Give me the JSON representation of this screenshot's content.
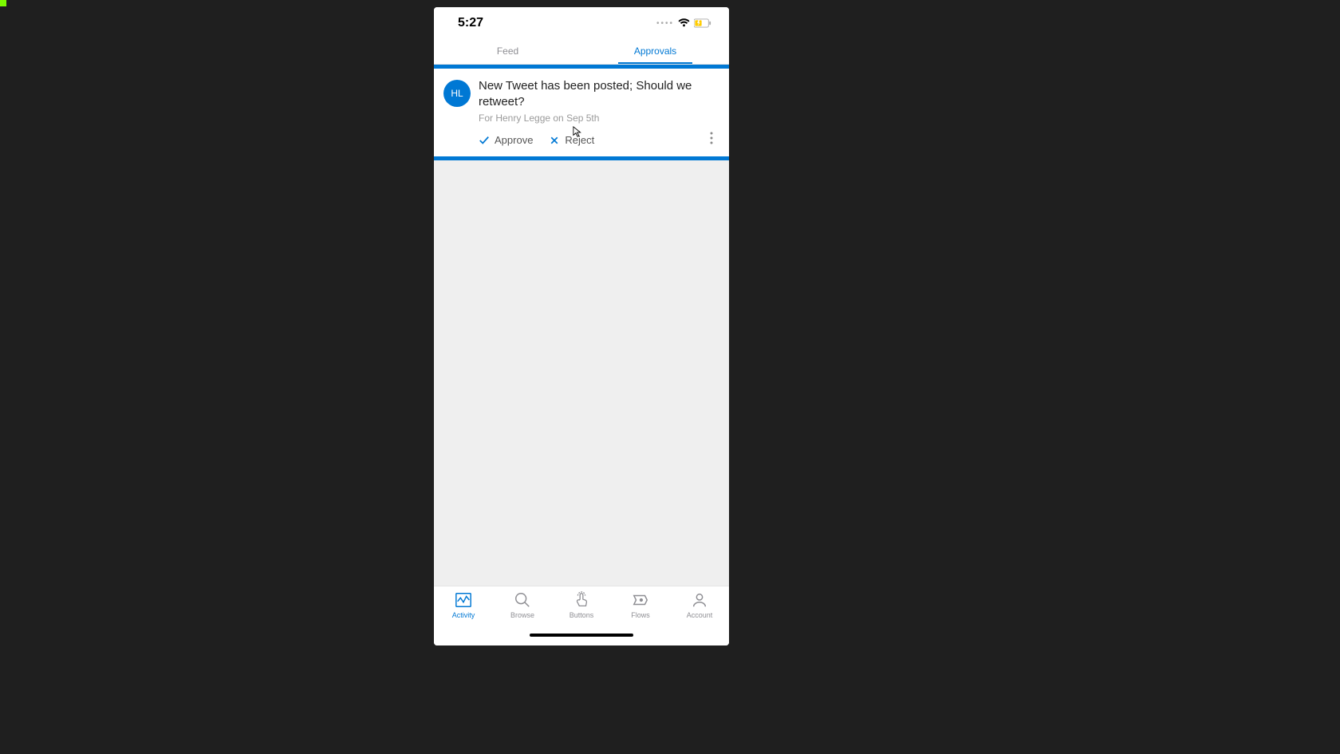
{
  "status": {
    "time": "5:27"
  },
  "tabs": {
    "feed": "Feed",
    "approvals": "Approvals"
  },
  "card": {
    "avatar_initials": "HL",
    "title": "New Tweet has been posted; Should we retweet?",
    "meta": "For Henry Legge on Sep 5th",
    "approve_label": "Approve",
    "reject_label": "Reject"
  },
  "bottom_nav": {
    "activity": "Activity",
    "browse": "Browse",
    "buttons": "Buttons",
    "flows": "Flows",
    "account": "Account"
  }
}
